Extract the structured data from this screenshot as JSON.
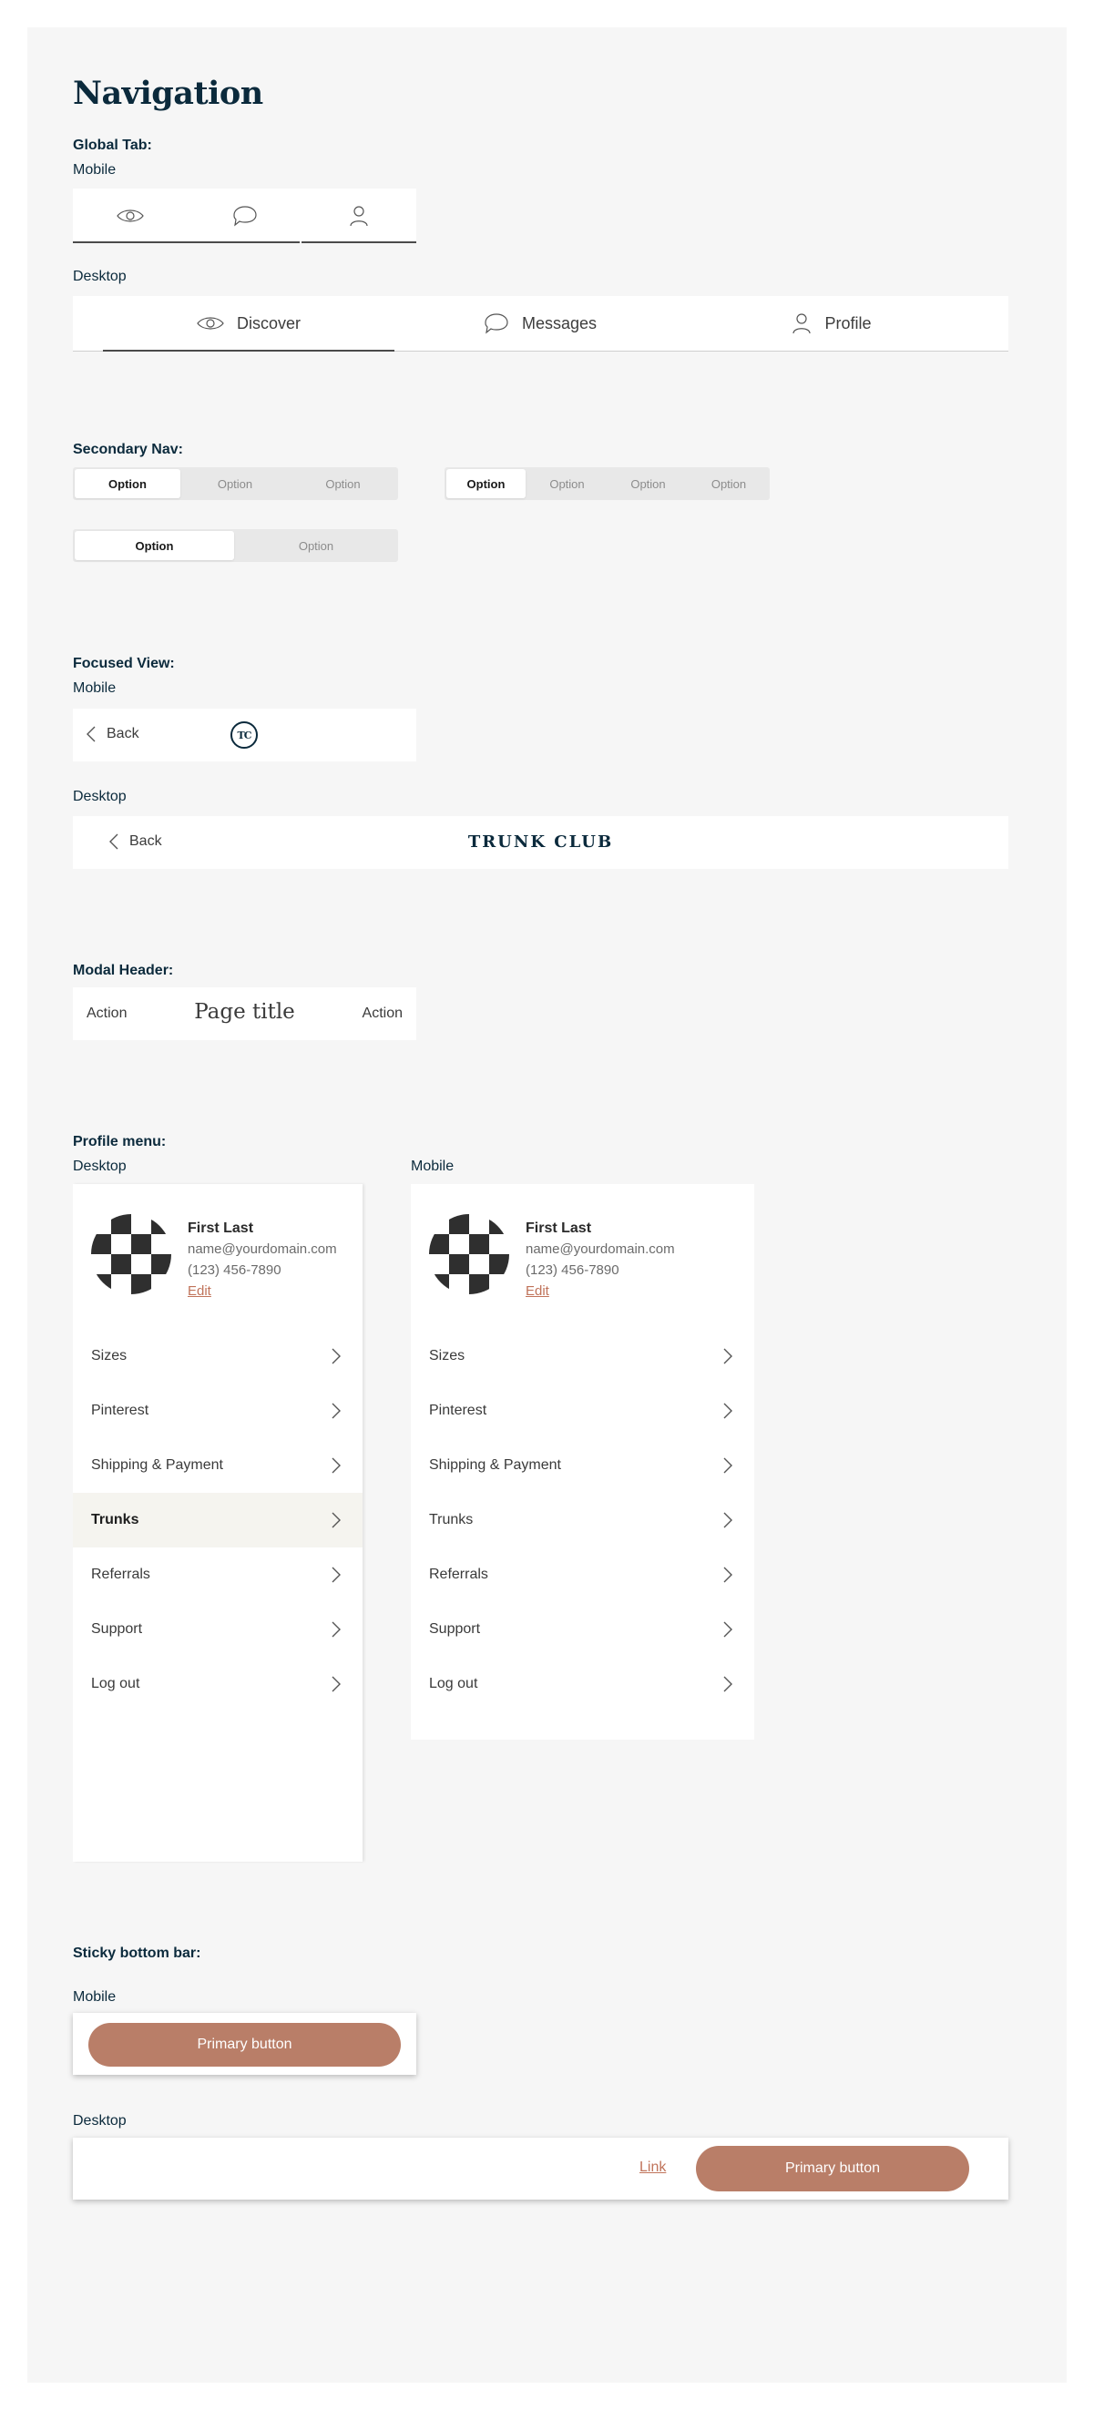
{
  "page": {
    "title": "Navigation"
  },
  "global_tab": {
    "title": "Global Tab:",
    "mobile_label": "Mobile",
    "desktop_label": "Desktop",
    "tabs": [
      {
        "label": "Discover",
        "icon": "eye-icon"
      },
      {
        "label": "Messages",
        "icon": "chat-bubble-icon"
      },
      {
        "label": "Profile",
        "icon": "person-icon"
      }
    ]
  },
  "secondary_nav": {
    "title": "Secondary Nav:",
    "group_three": [
      "Option",
      "Option",
      "Option"
    ],
    "group_four": [
      "Option",
      "Option",
      "Option",
      "Option"
    ],
    "group_two": [
      "Option",
      "Option"
    ]
  },
  "focused_view": {
    "title": "Focused View:",
    "mobile_label": "Mobile",
    "desktop_label": "Desktop",
    "back_label": "Back",
    "logo_monogram": "TC",
    "logo_wordmark": "TRUNK CLUB"
  },
  "modal_header": {
    "title": "Modal Header:",
    "left_action": "Action",
    "page_title": "Page title",
    "right_action": "Action"
  },
  "profile_menu": {
    "title": "Profile menu:",
    "desktop_label": "Desktop",
    "mobile_label": "Mobile",
    "user": {
      "name": "First Last",
      "email": "name@yourdomain.com",
      "phone": "(123) 456-7890",
      "edit_label": "Edit"
    },
    "items": [
      "Sizes",
      "Pinterest",
      "Shipping & Payment",
      "Trunks",
      "Referrals",
      "Support",
      "Log out"
    ],
    "active_item_desktop": "Trunks"
  },
  "sticky_bar": {
    "title": "Sticky bottom bar:",
    "mobile_label": "Mobile",
    "desktop_label": "Desktop",
    "primary_label": "Primary button",
    "link_label": "Link"
  },
  "colors": {
    "navy": "#0b2a3c",
    "accent": "#b97e68",
    "link": "#c0735a",
    "panel": "#f6f6f6"
  }
}
